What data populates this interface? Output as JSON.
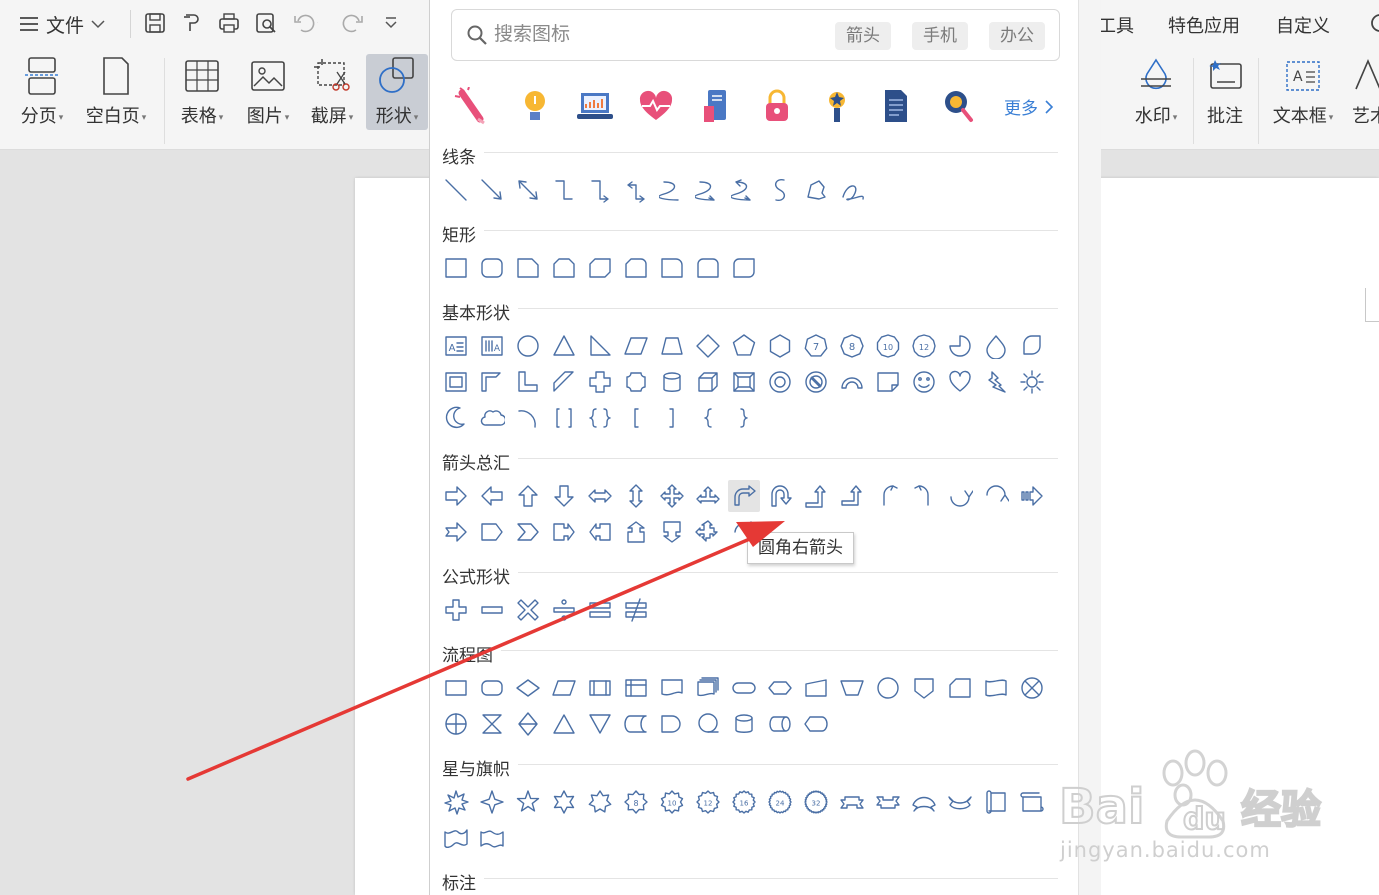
{
  "ribbon": {
    "file_menu": "文件",
    "tabs_right": [
      "工具",
      "特色应用",
      "自定义"
    ],
    "buttons": [
      {
        "label": "分页"
      },
      {
        "label": "空白页"
      },
      {
        "label": "表格"
      },
      {
        "label": "图片"
      },
      {
        "label": "截屏"
      },
      {
        "label": "形状"
      }
    ],
    "buttons_right": [
      {
        "label": "水印"
      },
      {
        "label": "批注"
      },
      {
        "label": "文本框"
      },
      {
        "label": "艺术字"
      }
    ]
  },
  "shape_panel": {
    "search": {
      "placeholder": "搜索图标",
      "chips": [
        "箭头",
        "手机",
        "办公"
      ]
    },
    "icon_strip": {
      "icons": [
        "firework-rocket-icon",
        "lightbulb-icon",
        "laptop-chart-icon",
        "heart-pulse-icon",
        "books-icon",
        "padlock-icon",
        "award-icon",
        "document-icon",
        "magnifier-gear-icon"
      ],
      "more_label": "更多"
    },
    "sections": [
      {
        "title": "线条"
      },
      {
        "title": "矩形"
      },
      {
        "title": "基本形状"
      },
      {
        "title": "箭头总汇"
      },
      {
        "title": "公式形状"
      },
      {
        "title": "流程图"
      },
      {
        "title": "星与旗帜"
      },
      {
        "title": "标注"
      }
    ],
    "tooltip": "圆角右箭头",
    "accent_color": "#4a6fa5"
  },
  "watermark": {
    "brand": "Bai du 经验",
    "url": "jingyan.baidu.com"
  }
}
